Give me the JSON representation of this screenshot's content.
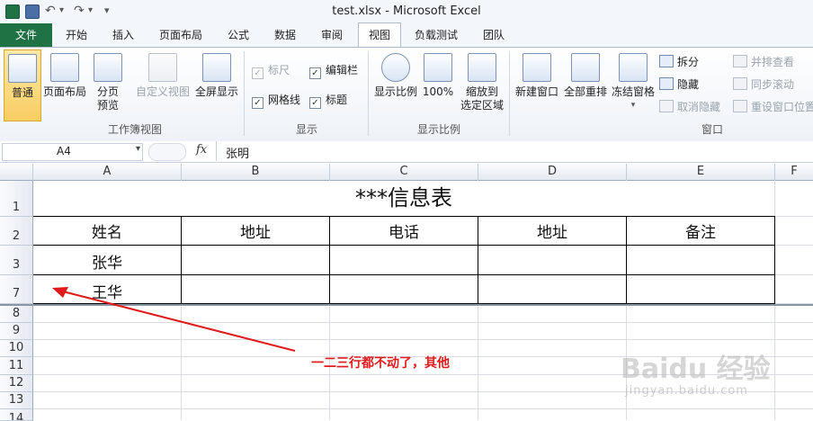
{
  "window": {
    "title": "test.xlsx  -  Microsoft Excel"
  },
  "qat": {
    "save_icon": "save-icon",
    "undo_icon": "undo-icon",
    "redo_icon": "redo-icon",
    "customize": "▾"
  },
  "tabs": [
    {
      "label": "文件"
    },
    {
      "label": "开始"
    },
    {
      "label": "插入"
    },
    {
      "label": "页面布局"
    },
    {
      "label": "公式"
    },
    {
      "label": "数据"
    },
    {
      "label": "审阅"
    },
    {
      "label": "视图"
    },
    {
      "label": "负载测试"
    },
    {
      "label": "团队"
    }
  ],
  "ribbon": {
    "workbook_views": {
      "label": "工作簿视图",
      "normal": "普通",
      "page_layout": "页面布局",
      "page_break": [
        "分页",
        "预览"
      ],
      "custom_views": "自定义视图",
      "full_screen": "全屏显示"
    },
    "show": {
      "label": "显示",
      "ruler": "标尺",
      "formula_bar": "编辑栏",
      "gridlines": "网格线",
      "headings": "标题"
    },
    "zoom": {
      "label": "显示比例",
      "zoom": "显示比例",
      "hundred": "100%",
      "zoom_to_selection": [
        "缩放到",
        "选定区域"
      ]
    },
    "window": {
      "label": "窗口",
      "new_window": "新建窗口",
      "arrange_all": "全部重排",
      "freeze_panes": "冻结窗格",
      "split": "拆分",
      "hide": "隐藏",
      "unhide": "取消隐藏",
      "side_by_side": "并排查看",
      "sync_scroll": "同步滚动",
      "reset_position": "重设窗口位置"
    }
  },
  "formula_bar": {
    "name_box": "A4",
    "fx": "fx",
    "value": "张明"
  },
  "sheet": {
    "columns": [
      "A",
      "B",
      "C",
      "D",
      "E",
      "F"
    ],
    "row_numbers": [
      "1",
      "2",
      "3",
      "7",
      "8",
      "9",
      "10",
      "11",
      "12",
      "13",
      "14"
    ],
    "title": "***信息表",
    "headers": [
      "姓名",
      "地址",
      "电话",
      "地址",
      "备注"
    ],
    "rows": [
      [
        "张华",
        "",
        "",
        "",
        ""
      ],
      [
        "王华",
        "",
        "",
        "",
        ""
      ]
    ]
  },
  "annotation": {
    "text": "一二三行都不动了，其他",
    "color": "#e01a1a"
  },
  "watermark": {
    "logo": "Baidu 经验",
    "url": "jingyan.baidu.com"
  }
}
